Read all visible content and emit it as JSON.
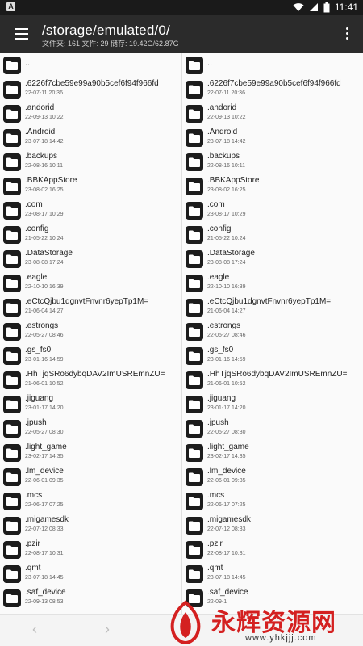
{
  "status_bar": {
    "app_badge": "A",
    "time": "11:41",
    "icons": [
      "wifi-icon",
      "signal-icon",
      "battery-icon"
    ]
  },
  "app_bar": {
    "path": "/storage/emulated/0/",
    "stats": "文件夹: 161   文件: 29   储存: 19.42G/62.87G"
  },
  "left_pane": {
    "items": [
      {
        "name": "..",
        "date": ""
      },
      {
        "name": ".6226f7cbe59e99a90b5cef6f94f966fd",
        "date": "22-07-11 20:36"
      },
      {
        "name": ".andorid",
        "date": "22-09-13 10:22"
      },
      {
        "name": ".Android",
        "date": "23-07-18 14:42"
      },
      {
        "name": ".backups",
        "date": "22-08-16 10:11"
      },
      {
        "name": ".BBKAppStore",
        "date": "23-08-02 16:25"
      },
      {
        "name": ".com",
        "date": "23-08-17 10:29"
      },
      {
        "name": ".config",
        "date": "21-05-22 10:24"
      },
      {
        "name": ".DataStorage",
        "date": "23-08-08 17:24"
      },
      {
        "name": ".eagle",
        "date": "22-10-10 16:39"
      },
      {
        "name": ".eCtcQjbu1dgnvtFnvnr6yepTp1M=",
        "date": "21-06-04 14:27"
      },
      {
        "name": ".estrongs",
        "date": "22-05-27 08:46"
      },
      {
        "name": ".gs_fs0",
        "date": "23-01-16 14:59"
      },
      {
        "name": ".HhTjqSRo6dybqDAV2ImUSREmnZU=",
        "date": "21-06-01 10:52"
      },
      {
        "name": ".jiguang",
        "date": "23-01-17 14:20"
      },
      {
        "name": ".jpush",
        "date": "22-05-27 08:30"
      },
      {
        "name": ".light_game",
        "date": "23-02-17 14:35"
      },
      {
        "name": ".lm_device",
        "date": "22-06-01 09:35"
      },
      {
        "name": ".mcs",
        "date": "22-06-17 07:25"
      },
      {
        "name": ".migamesdk",
        "date": "22-07-12 08:33"
      },
      {
        "name": ".pzir",
        "date": "22-08-17 10:31"
      },
      {
        "name": ".qmt",
        "date": "23-07-18 14:45"
      },
      {
        "name": ".saf_device",
        "date": "22-09-13 08:53"
      }
    ]
  },
  "right_pane": {
    "items": [
      {
        "name": "..",
        "date": ""
      },
      {
        "name": ".6226f7cbe59e99a90b5cef6f94f966fd",
        "date": "22-07-11 20:36"
      },
      {
        "name": ".andorid",
        "date": "22-09-13 10:22"
      },
      {
        "name": ".Android",
        "date": "23-07-18 14:42"
      },
      {
        "name": ".backups",
        "date": "22-08-16 10:11"
      },
      {
        "name": ".BBKAppStore",
        "date": "23-08-02 16:25"
      },
      {
        "name": ".com",
        "date": "23-08-17 10:29"
      },
      {
        "name": ".config",
        "date": "21-05-22 10:24"
      },
      {
        "name": ".DataStorage",
        "date": "23-08-08 17:24"
      },
      {
        "name": ".eagle",
        "date": "22-10-10 16:39"
      },
      {
        "name": ".eCtcQjbu1dgnvtFnvnr6yepTp1M=",
        "date": "21-06-04 14:27"
      },
      {
        "name": ".estrongs",
        "date": "22-05-27 08:46"
      },
      {
        "name": ".gs_fs0",
        "date": "23-01-16 14:59"
      },
      {
        "name": ".HhTjqSRo6dybqDAV2ImUSREmnZU=",
        "date": "21-06-01 10:52"
      },
      {
        "name": ".jiguang",
        "date": "23-01-17 14:20"
      },
      {
        "name": ".jpush",
        "date": "22-05-27 08:30"
      },
      {
        "name": ".light_game",
        "date": "23-02-17 14:35"
      },
      {
        "name": ".lm_device",
        "date": "22-06-01 09:35"
      },
      {
        "name": ".mcs",
        "date": "22-06-17 07:25"
      },
      {
        "name": ".migamesdk",
        "date": "22-07-12 08:33"
      },
      {
        "name": ".pzir",
        "date": "22-08-17 10:31"
      },
      {
        "name": ".qmt",
        "date": "23-07-18 14:45"
      },
      {
        "name": ".saf_device",
        "date": "22-09-1"
      }
    ]
  },
  "bottom_bar": {
    "back_arrow": "‹",
    "forward_arrow": "›"
  },
  "watermark": {
    "text": "永辉资源网",
    "url": "www.yhkjjj.com"
  },
  "colors": {
    "app_bar": "#2b2b2b",
    "status_bar": "#1a1a1a",
    "folder_icon": "#1c1c1c",
    "watermark": "#d42020"
  }
}
